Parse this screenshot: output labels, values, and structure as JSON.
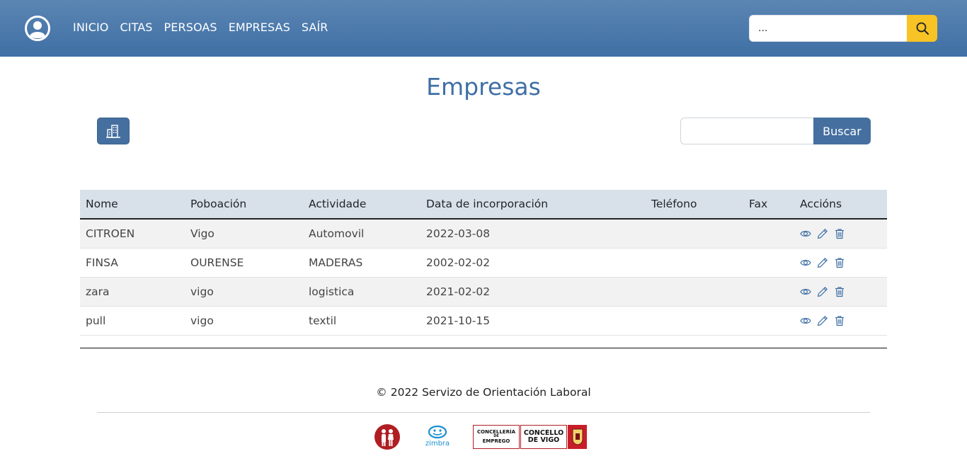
{
  "nav": {
    "links": [
      "INICIO",
      "CITAS",
      "PERSOAS",
      "EMPRESAS",
      "SAÍR"
    ],
    "search_value": "..."
  },
  "page": {
    "title": "Empresas",
    "search_placeholder": "",
    "search_button": "Buscar"
  },
  "table": {
    "columns": [
      "Nome",
      "Poboación",
      "Actividade",
      "Data de incorporación",
      "Teléfono",
      "Fax",
      "Accións"
    ],
    "rows": [
      {
        "nome": "CITROEN",
        "poboacion": "Vigo",
        "actividade": "Automovil",
        "data": "2022-03-08",
        "telefono": "",
        "fax": ""
      },
      {
        "nome": "FINSA",
        "poboacion": "OURENSE",
        "actividade": "MADERAS",
        "data": "2002-02-02",
        "telefono": "",
        "fax": ""
      },
      {
        "nome": "zara",
        "poboacion": "vigo",
        "actividade": "logistica",
        "data": "2021-02-02",
        "telefono": "",
        "fax": ""
      },
      {
        "nome": "pull",
        "poboacion": "vigo",
        "actividade": "textil",
        "data": "2021-10-15",
        "telefono": "",
        "fax": ""
      }
    ],
    "action_icons": [
      "eye-icon",
      "pencil-icon",
      "trash-icon"
    ]
  },
  "footer": {
    "copyright": "© 2022 Servizo de Orientación Laboral",
    "logos": {
      "zimbra": "zimbra",
      "concelleria_line1": "CONCELLERÍA",
      "concelleria_line2": "DE",
      "concelleria_line3": "EMPREGO",
      "concello_line1": "CONCELLO",
      "concello_line2": "DE VIGO"
    }
  },
  "colors": {
    "navbar": "#4a78aa",
    "accent": "#3f6fa5",
    "search_button": "#f7c325",
    "header_row": "#d8e1ea"
  }
}
